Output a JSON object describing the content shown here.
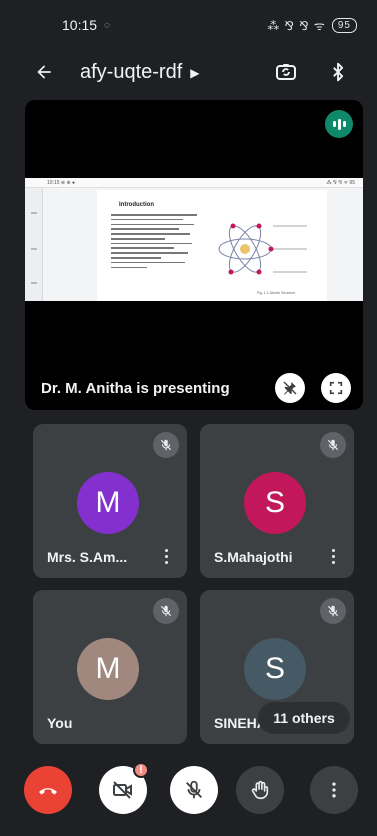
{
  "status_bar": {
    "time": "10:15",
    "status_icons": "⁂ ⅋ ⅋ ᯤ",
    "battery": "95"
  },
  "top_bar": {
    "meeting_code": "afy-uqte-rdf"
  },
  "presentation": {
    "presenter_label": "Dr. M. Anitha is presenting",
    "slide_status_left": "10:15 ⊕ ⊕ ●",
    "slide_status_right": "⁂ ⅋ ⅋ ᯤ 95",
    "slide_title": "Introduction",
    "slide_caption": "Fig. 1.1 Atomic Structure"
  },
  "participants": [
    {
      "initial": "M",
      "name": "Mrs. S.Am...",
      "avatar_color": "#8430ce",
      "muted": true,
      "has_menu": true
    },
    {
      "initial": "S",
      "name": "S.Mahajothi",
      "avatar_color": "#c2185b",
      "muted": true,
      "has_menu": true
    },
    {
      "initial": "M",
      "name": "You",
      "avatar_color": "#a1887f",
      "muted": true,
      "has_menu": false
    },
    {
      "initial": "S",
      "name": "SINEHA",
      "avatar_color": "#455a64",
      "muted": true,
      "has_menu": false
    }
  ],
  "others_label": "11 others",
  "controls": {
    "camera_badge": "!",
    "end_call_color": "#ea4335"
  }
}
